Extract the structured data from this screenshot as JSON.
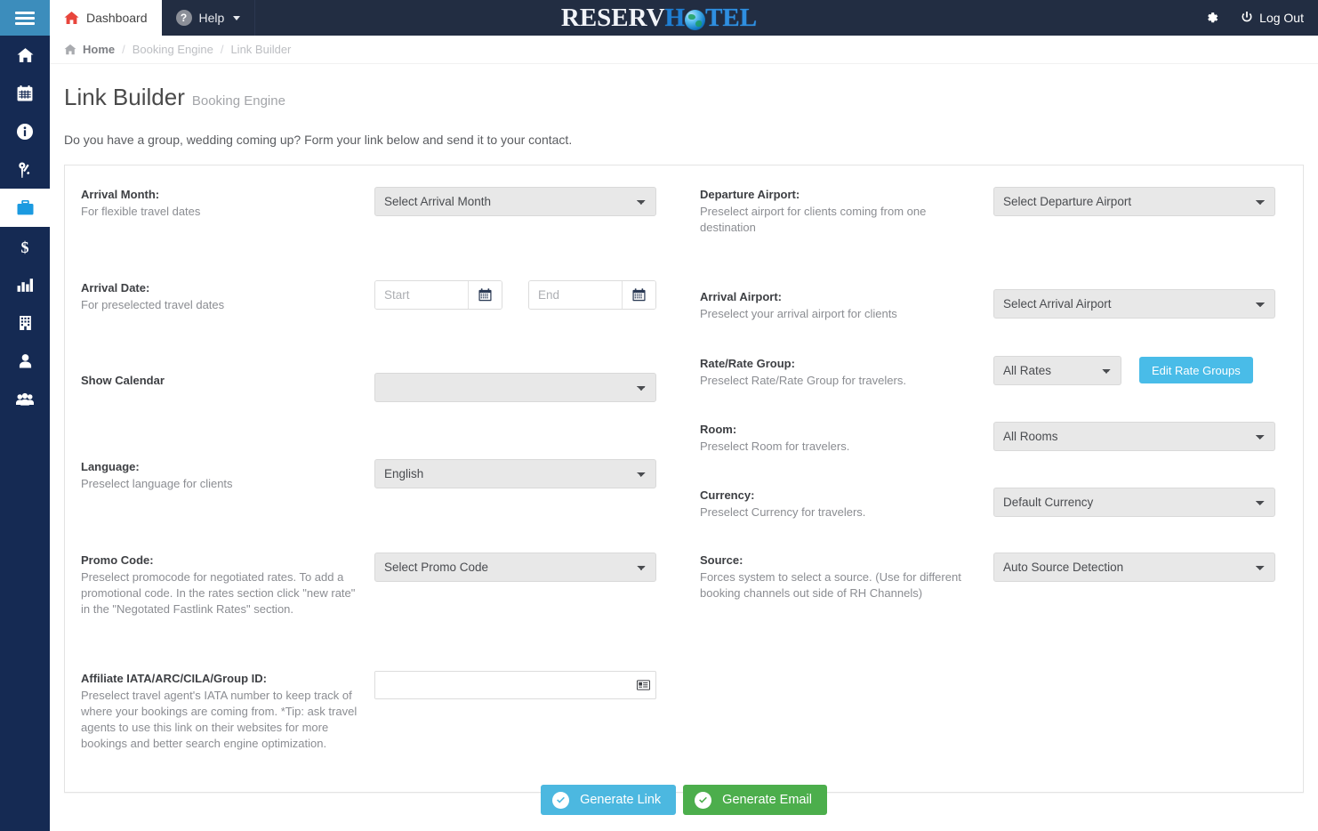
{
  "topbar": {
    "hamburger_icon": "hamburger-menu-icon",
    "tabs": [
      {
        "label": "Dashboard",
        "icon": "home-icon",
        "active": true,
        "caret": false
      },
      {
        "label": "Help",
        "icon": "question-circle-icon",
        "active": false,
        "caret": true
      }
    ],
    "logo": {
      "part1": "RESERV",
      "part2": "H",
      "globe": "globe-icon",
      "part3": "TEL"
    },
    "gear_icon": "gear-icon",
    "logout_label": "Log Out",
    "logout_icon": "power-icon",
    "accent_blue": "#3c8dbc",
    "bar_color": "#222d42"
  },
  "sidebar": {
    "items": [
      {
        "icon": "home-icon",
        "name": "sidebar-item-home",
        "active": false
      },
      {
        "icon": "calendar-icon",
        "name": "sidebar-item-calendar",
        "active": false
      },
      {
        "icon": "info-icon",
        "name": "sidebar-item-info",
        "active": false
      },
      {
        "icon": "key-icon",
        "name": "sidebar-item-key",
        "active": false
      },
      {
        "icon": "briefcase-icon",
        "name": "sidebar-item-booking-engine",
        "active": true
      },
      {
        "icon": "dollar-icon",
        "name": "sidebar-item-revenue",
        "active": false
      },
      {
        "icon": "bar-chart-icon",
        "name": "sidebar-item-reports",
        "active": false
      },
      {
        "icon": "building-icon",
        "name": "sidebar-item-property",
        "active": false
      },
      {
        "icon": "user-icon",
        "name": "sidebar-item-user",
        "active": false
      },
      {
        "icon": "users-icon",
        "name": "sidebar-item-users",
        "active": false
      }
    ],
    "active_icon_color": "#1b9ae0",
    "background": "#152a53"
  },
  "breadcrumb": {
    "home": "Home",
    "sep": "/",
    "crumb1": "Booking Engine",
    "crumb2": "Link Builder"
  },
  "page": {
    "title": "Link Builder",
    "subtitle": "Booking Engine",
    "description": "Do you have a group, wedding coming up? Form your link below and send it to your contact."
  },
  "fields": {
    "arrival_month": {
      "label": "Arrival Month:",
      "hint": "For flexible travel dates",
      "value": "Select Arrival Month"
    },
    "arrival_date": {
      "label": "Arrival Date:",
      "hint": "For preselected travel dates",
      "start_placeholder": "Start",
      "start_value": "",
      "end_placeholder": "End",
      "end_value": "",
      "calendar_icon": "calendar-icon"
    },
    "show_calendar": {
      "label": "Show Calendar",
      "hint": "",
      "value": ""
    },
    "language": {
      "label": "Language:",
      "hint": "Preselect language for clients",
      "value": "English"
    },
    "promo_code": {
      "label": "Promo Code:",
      "hint": "Preselect promocode for negotiated rates. To add a promotional code. In the rates section click \"new rate\" in the \"Negotated Fastlink Rates\" section.",
      "value": "Select Promo Code"
    },
    "affiliate": {
      "label": "Affiliate IATA/ARC/CILA/Group ID:",
      "hint": "Preselect travel agent's IATA number to keep track of where your bookings are coming from. *Tip: ask travel agents to use this link on their websites for more bookings and better search engine optimization.",
      "value": "",
      "placeholder": "",
      "icon": "id-card-icon"
    },
    "departure_airport": {
      "label": "Departure Airport:",
      "hint": "Preselect airport for clients coming from one destination",
      "value": "Select Departure Airport"
    },
    "arrival_airport": {
      "label": "Arrival Airport:",
      "hint": "Preselect your arrival airport for clients",
      "value": "Select Arrival Airport"
    },
    "rate_group": {
      "label": "Rate/Rate Group:",
      "hint": "Preselect Rate/Rate Group for travelers.",
      "value": "All Rates",
      "button_label": "Edit Rate Groups",
      "button_color": "#49bce8"
    },
    "room": {
      "label": "Room:",
      "hint": "Preselect Room for travelers.",
      "value": "All Rooms"
    },
    "currency": {
      "label": "Currency:",
      "hint": "Preselect Currency for travelers.",
      "value": "Default Currency"
    },
    "source": {
      "label": "Source:",
      "hint": "Forces system to select a source. (Use for different booking channels out side of RH Channels)",
      "value": "Auto Source Detection"
    }
  },
  "footer": {
    "generate_link_label": "Generate Link",
    "generate_link_color": "#4cb8e0",
    "generate_email_label": "Generate Email",
    "generate_email_color": "#4cae4c",
    "check_icon": "check-circle-icon"
  }
}
